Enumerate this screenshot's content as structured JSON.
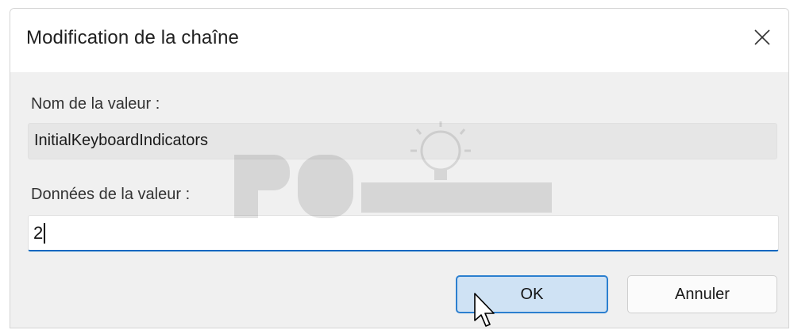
{
  "window": {
    "title": "Modification de la chaîne",
    "close_icon": "close-icon"
  },
  "form": {
    "name_label": "Nom de la valeur :",
    "name_value": "InitialKeyboardIndicators",
    "data_label": "Données de la valeur :",
    "data_value": "2"
  },
  "buttons": {
    "ok_label": "OK",
    "cancel_label": "Annuler"
  },
  "colors": {
    "accent": "#0067c0",
    "ok_button_bg": "#cfe2f4",
    "body_bg": "#f0f0f0"
  },
  "icons": {
    "cursor": "mouse-pointer-icon"
  }
}
